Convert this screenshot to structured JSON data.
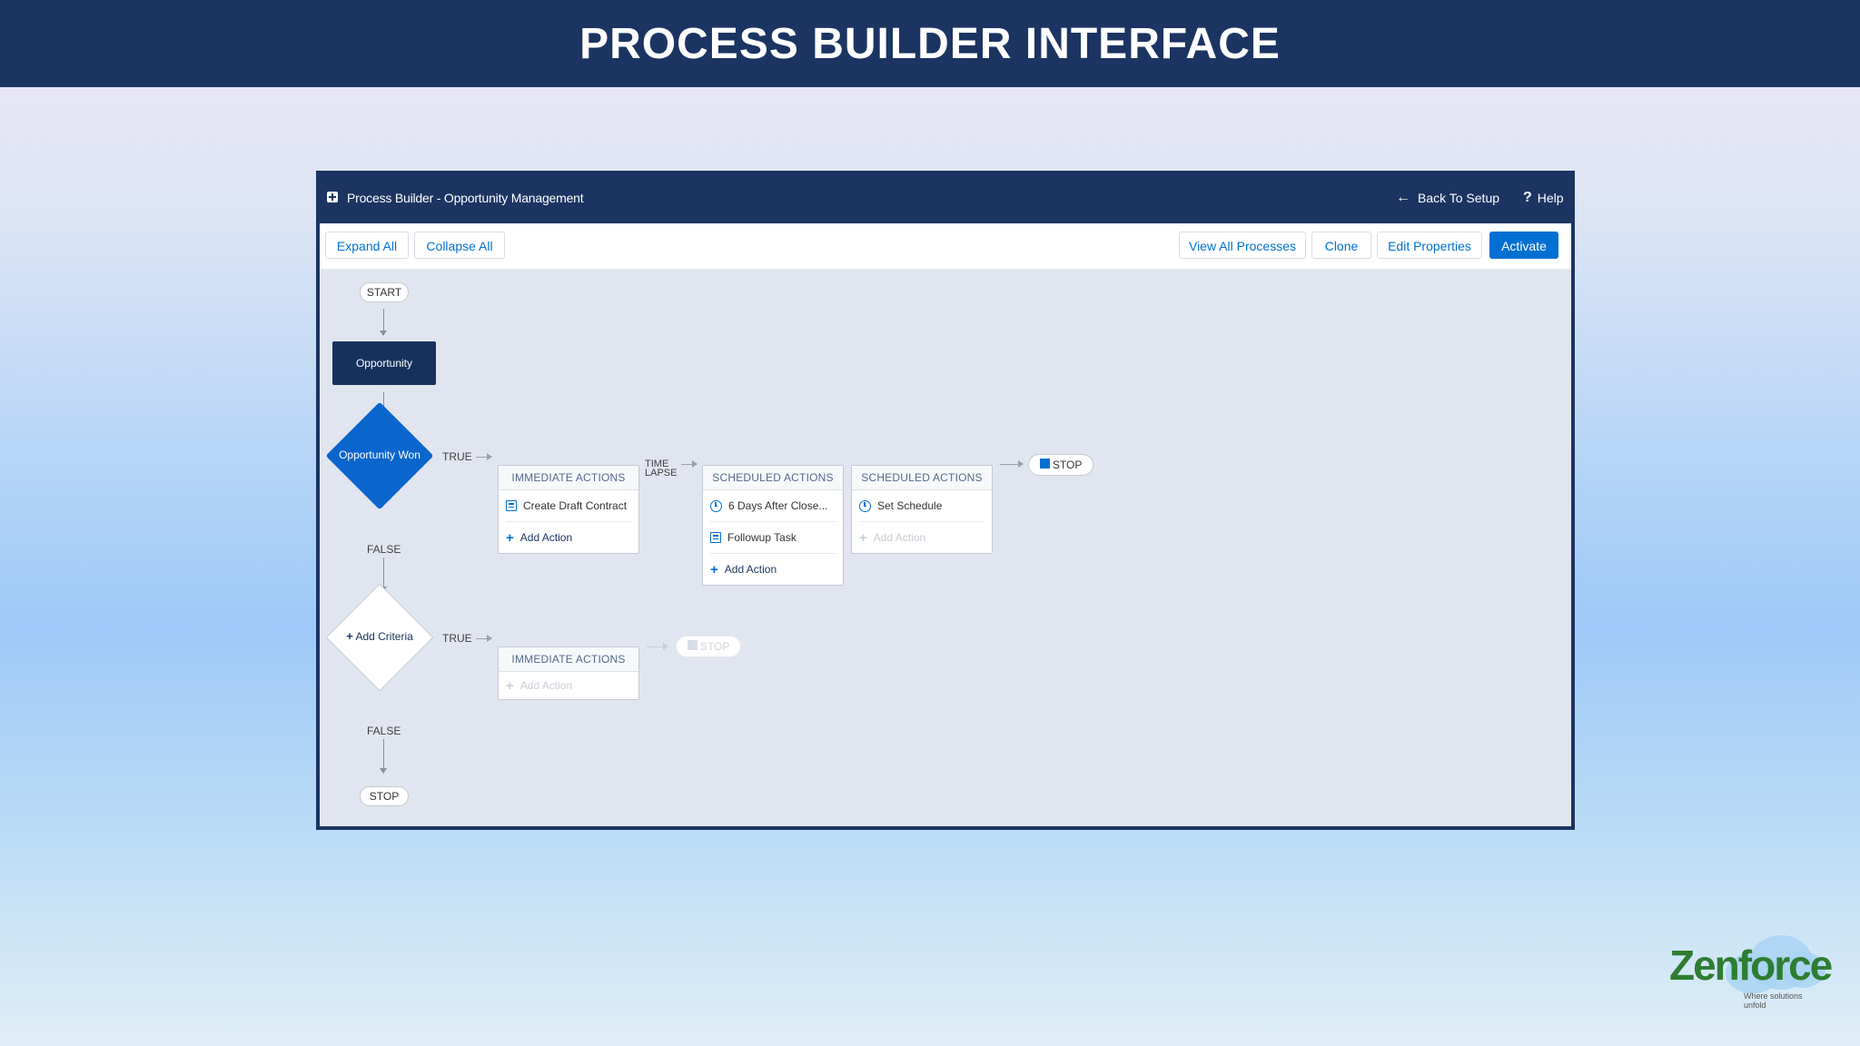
{
  "slide": {
    "title": "PROCESS BUILDER INTERFACE"
  },
  "window": {
    "title": "Process Builder - Opportunity Management",
    "back_link": "Back To Setup",
    "help_link": "Help"
  },
  "toolbar": {
    "expand_all": "Expand All",
    "collapse_all": "Collapse All",
    "view_all": "View All Processes",
    "clone": "Clone",
    "edit_properties": "Edit Properties",
    "activate": "Activate"
  },
  "flow": {
    "start": "START",
    "object": "Opportunity",
    "criteria_1": "Opportunity Won",
    "true_label": "TRUE",
    "false_label": "FALSE",
    "time_lapse": [
      "TIME",
      "LAPSE"
    ],
    "immediate_1": {
      "header": "IMMEDIATE ACTIONS",
      "items": [
        "Create Draft Contract"
      ],
      "add": "Add Action"
    },
    "scheduled_1": {
      "header": "SCHEDULED ACTIONS",
      "schedule": "6 Days After Close...",
      "items": [
        "Followup Task"
      ],
      "add": "Add Action"
    },
    "scheduled_2": {
      "header": "SCHEDULED ACTIONS",
      "schedule": "Set Schedule",
      "add": "Add Action"
    },
    "stop": "STOP",
    "criteria_2": "Add Criteria",
    "immediate_2": {
      "header": "IMMEDIATE ACTIONS",
      "add": "Add Action"
    },
    "stop_2": "STOP",
    "end_stop": "STOP"
  },
  "logo": {
    "name": "Zenforce",
    "tagline": "Where solutions unfold"
  },
  "colors": {
    "navy": "#1c3461",
    "accent": "#0070d2",
    "logo_green": "#2e7d32"
  }
}
